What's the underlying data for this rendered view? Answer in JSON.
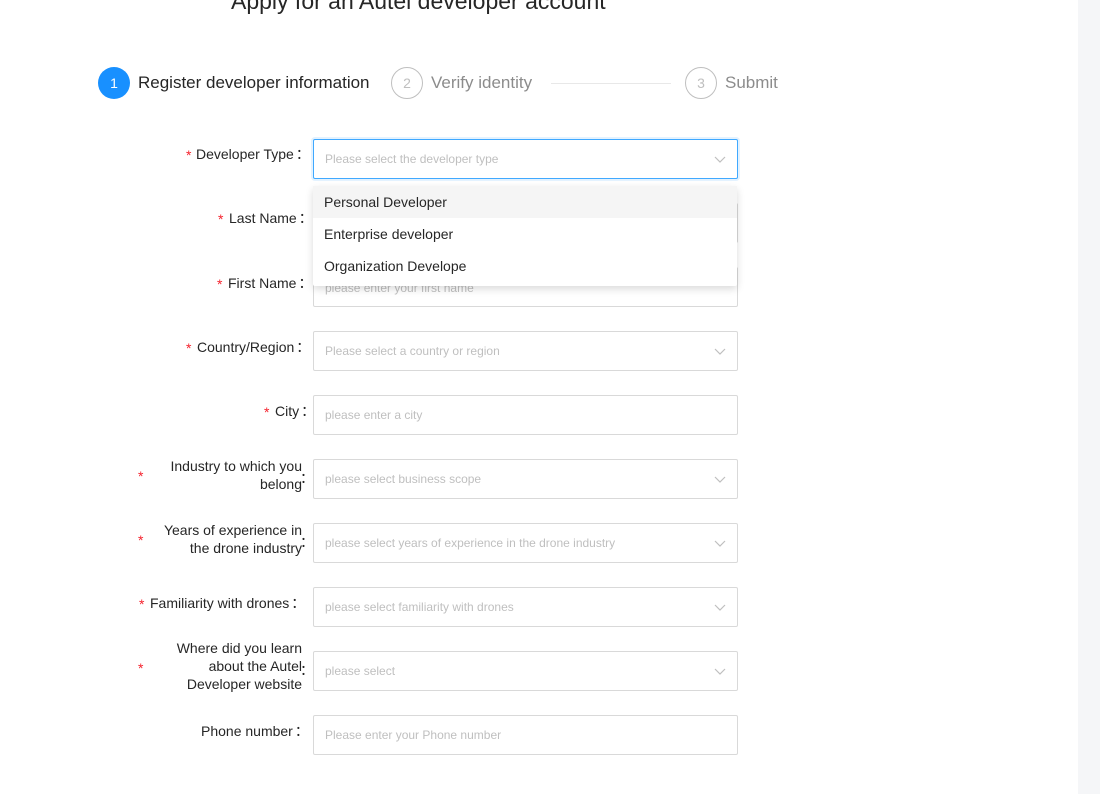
{
  "page": {
    "title": "Apply for an Autel developer account"
  },
  "steps": [
    {
      "number": "1",
      "label": "Register developer information",
      "state": "active"
    },
    {
      "number": "2",
      "label": "Verify identity",
      "state": "idle"
    },
    {
      "number": "3",
      "label": "Submit",
      "state": "idle"
    }
  ],
  "form": {
    "developer_type": {
      "label": "Developer Type",
      "placeholder": "Please select the developer type",
      "required": true
    },
    "last_name": {
      "label": "Last Name",
      "required": true
    },
    "first_name": {
      "label": "First Name",
      "placeholder": "please enter your first name",
      "required": true
    },
    "country": {
      "label": "Country/Region",
      "placeholder": "Please select a country or region",
      "required": true
    },
    "city": {
      "label": "City",
      "placeholder": "please enter a city",
      "required": true
    },
    "industry": {
      "label": "Industry to which you belong",
      "placeholder": "please select business scope",
      "required": true
    },
    "experience": {
      "label": "Years of experience in the drone industry",
      "placeholder": "please select years of experience in the drone industry",
      "required": true
    },
    "familiarity": {
      "label": "Familiarity with drones",
      "placeholder": "please select familiarity with drones",
      "required": true
    },
    "source": {
      "label": "Where did you learn about the Autel Developer website",
      "placeholder": "please select",
      "required": true
    },
    "phone": {
      "label": "Phone number",
      "placeholder": "Please enter your Phone number",
      "required": false
    },
    "colon": "："
  },
  "dropdown": {
    "options": [
      "Personal Developer",
      "Enterprise developer",
      "Organization Develope"
    ],
    "hovered_index": 0
  },
  "colors": {
    "accent": "#1890ff",
    "required": "#f5222d"
  }
}
